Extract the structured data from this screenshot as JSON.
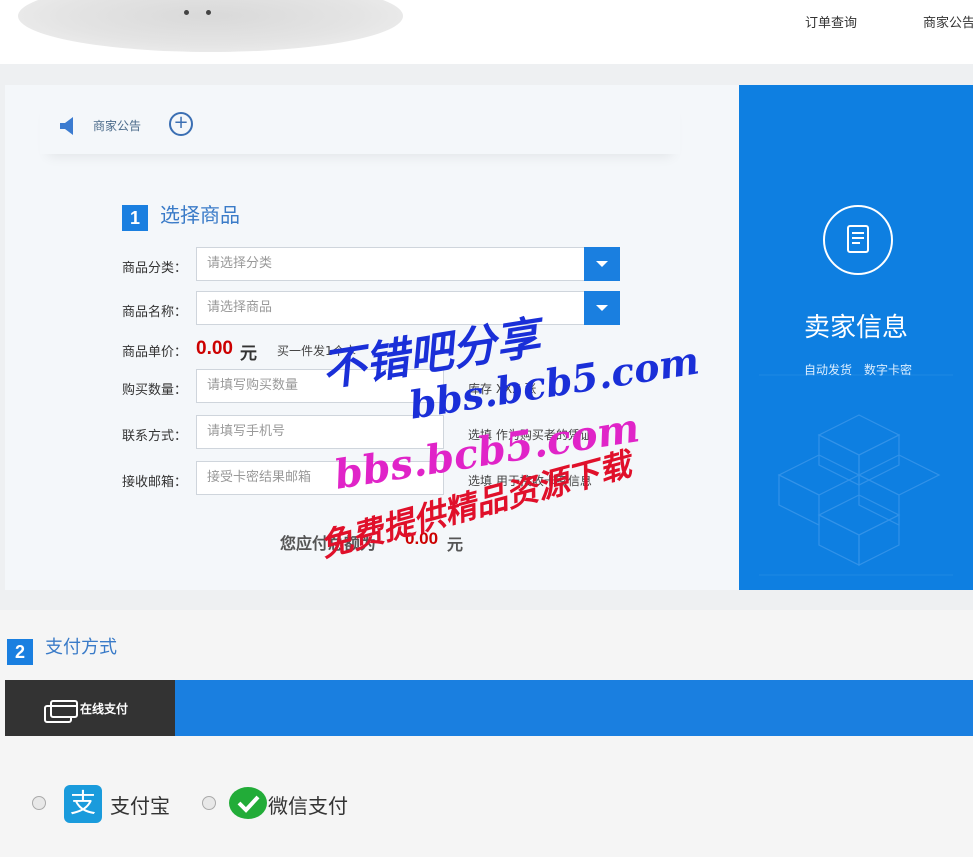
{
  "header": {
    "nav": [
      "订单查询",
      "商家公告"
    ]
  },
  "notice": {
    "label": "商家公告",
    "plus": "+"
  },
  "step1": {
    "number": "1",
    "title": "选择商品",
    "category_label": "商品分类：",
    "category_placeholder": "请选择分类",
    "product_label": "商品名称：",
    "product_placeholder": "请选择商品",
    "price_label": "商品单价：",
    "price_value": "0.00",
    "price_unit": "元",
    "price_hint": "买一件发1个卡",
    "qty_label": "购买数量：",
    "qty_placeholder": "请填写购买数量",
    "stock_hint": "库存 XXX 张",
    "contact_label": "联系方式：",
    "contact_placeholder": "请填写手机号",
    "contact_hint": "选填 作为购买者的凭证",
    "email_label": "接收邮箱：",
    "email_placeholder": "接受卡密结果邮箱",
    "email_hint": "选填 用于接收卡密信息",
    "total_label": "您应付总额为",
    "total_value": "0.00",
    "total_unit": "元"
  },
  "seller": {
    "title": "卖家信息",
    "tags": [
      "自动发货",
      "数字卡密"
    ]
  },
  "step2": {
    "number": "2",
    "title": "支付方式",
    "tab_label": "在线支付",
    "methods": [
      {
        "name": "支付宝",
        "icon": "alipay-icon",
        "color": "#1a9bdc"
      },
      {
        "name": "微信支付",
        "icon": "wechat-icon",
        "color": "#22ac38"
      }
    ]
  },
  "watermark": {
    "line1": "不错吧分享",
    "line2": "bbs.bcb5.com",
    "line3": "bbs.bcb5.com",
    "line4": "免费提供精品资源下载"
  },
  "colors": {
    "accent": "#1a7fe0",
    "price": "#cc0000",
    "dark_tab": "#333333"
  }
}
